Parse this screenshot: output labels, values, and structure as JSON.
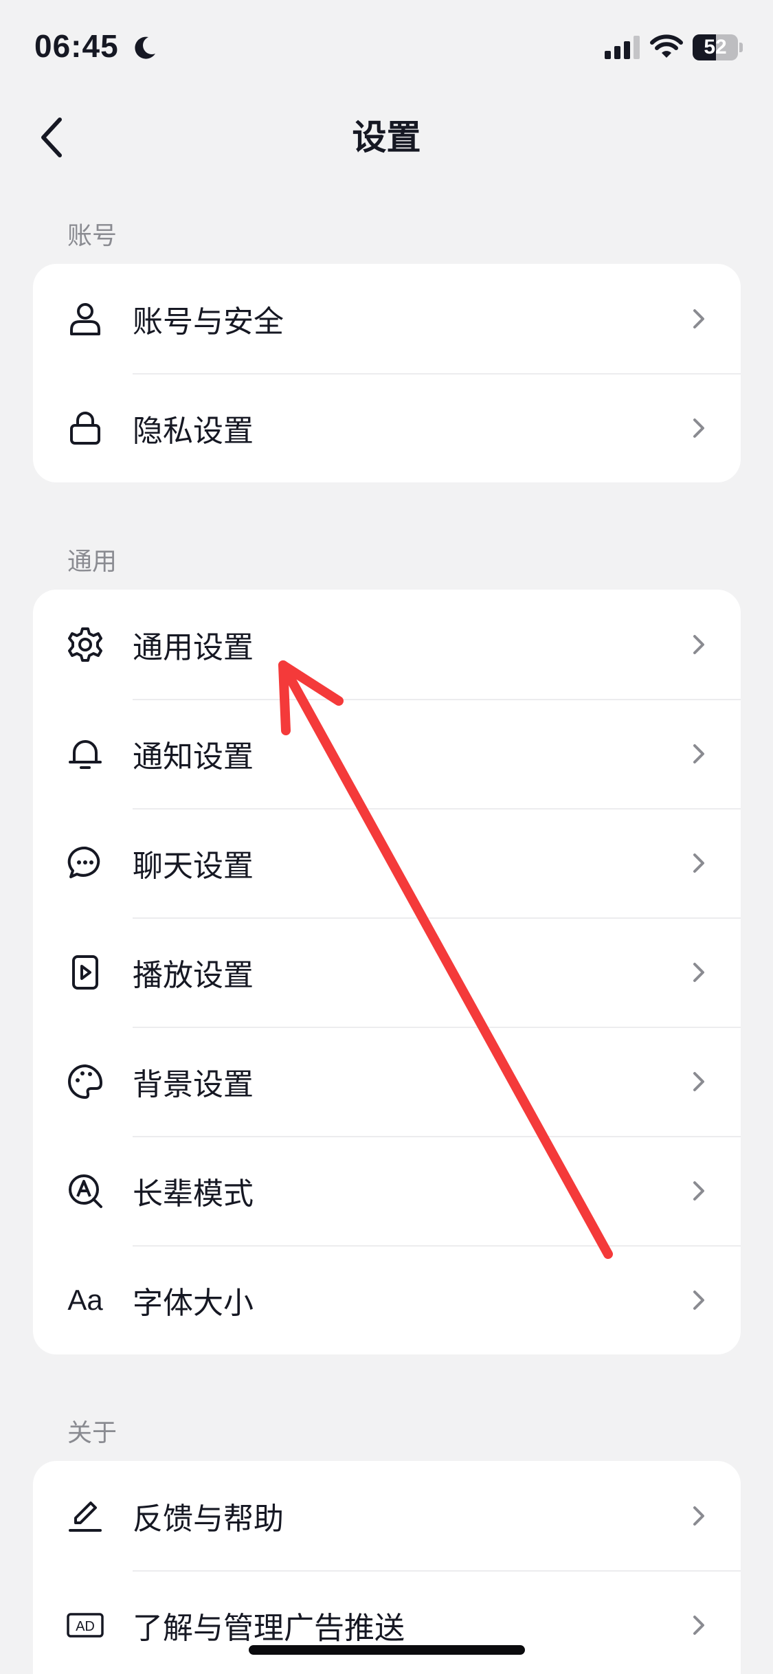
{
  "status_bar": {
    "time": "06:45",
    "battery_level": "52",
    "icons": [
      "moon-icon",
      "cellular-signal-icon",
      "wifi-icon",
      "battery-icon"
    ]
  },
  "nav": {
    "title": "设置",
    "back_icon": "chevron-left-icon"
  },
  "sections": [
    {
      "label": "账号",
      "items": [
        {
          "label": "账号与安全",
          "icon": "user-icon"
        },
        {
          "label": "隐私设置",
          "icon": "lock-icon"
        }
      ]
    },
    {
      "label": "通用",
      "items": [
        {
          "label": "通用设置",
          "icon": "gear-icon"
        },
        {
          "label": "通知设置",
          "icon": "bell-icon"
        },
        {
          "label": "聊天设置",
          "icon": "chat-bubble-icon"
        },
        {
          "label": "播放设置",
          "icon": "play-icon"
        },
        {
          "label": "背景设置",
          "icon": "palette-icon"
        },
        {
          "label": "长辈模式",
          "icon": "elder-mode-icon"
        },
        {
          "label": "字体大小",
          "icon": "font-size-icon",
          "icon_text": "Aa"
        }
      ]
    },
    {
      "label": "关于",
      "items": [
        {
          "label": "反馈与帮助",
          "icon": "edit-icon"
        },
        {
          "label": "了解与管理广告推送",
          "icon": "ad-icon",
          "icon_text": "AD"
        }
      ]
    }
  ],
  "colors": {
    "background": "#f2f2f3",
    "card": "#ffffff",
    "text": "#161823",
    "secondary_text": "#8a8b91",
    "annotation_arrow": "#f43a3a"
  }
}
